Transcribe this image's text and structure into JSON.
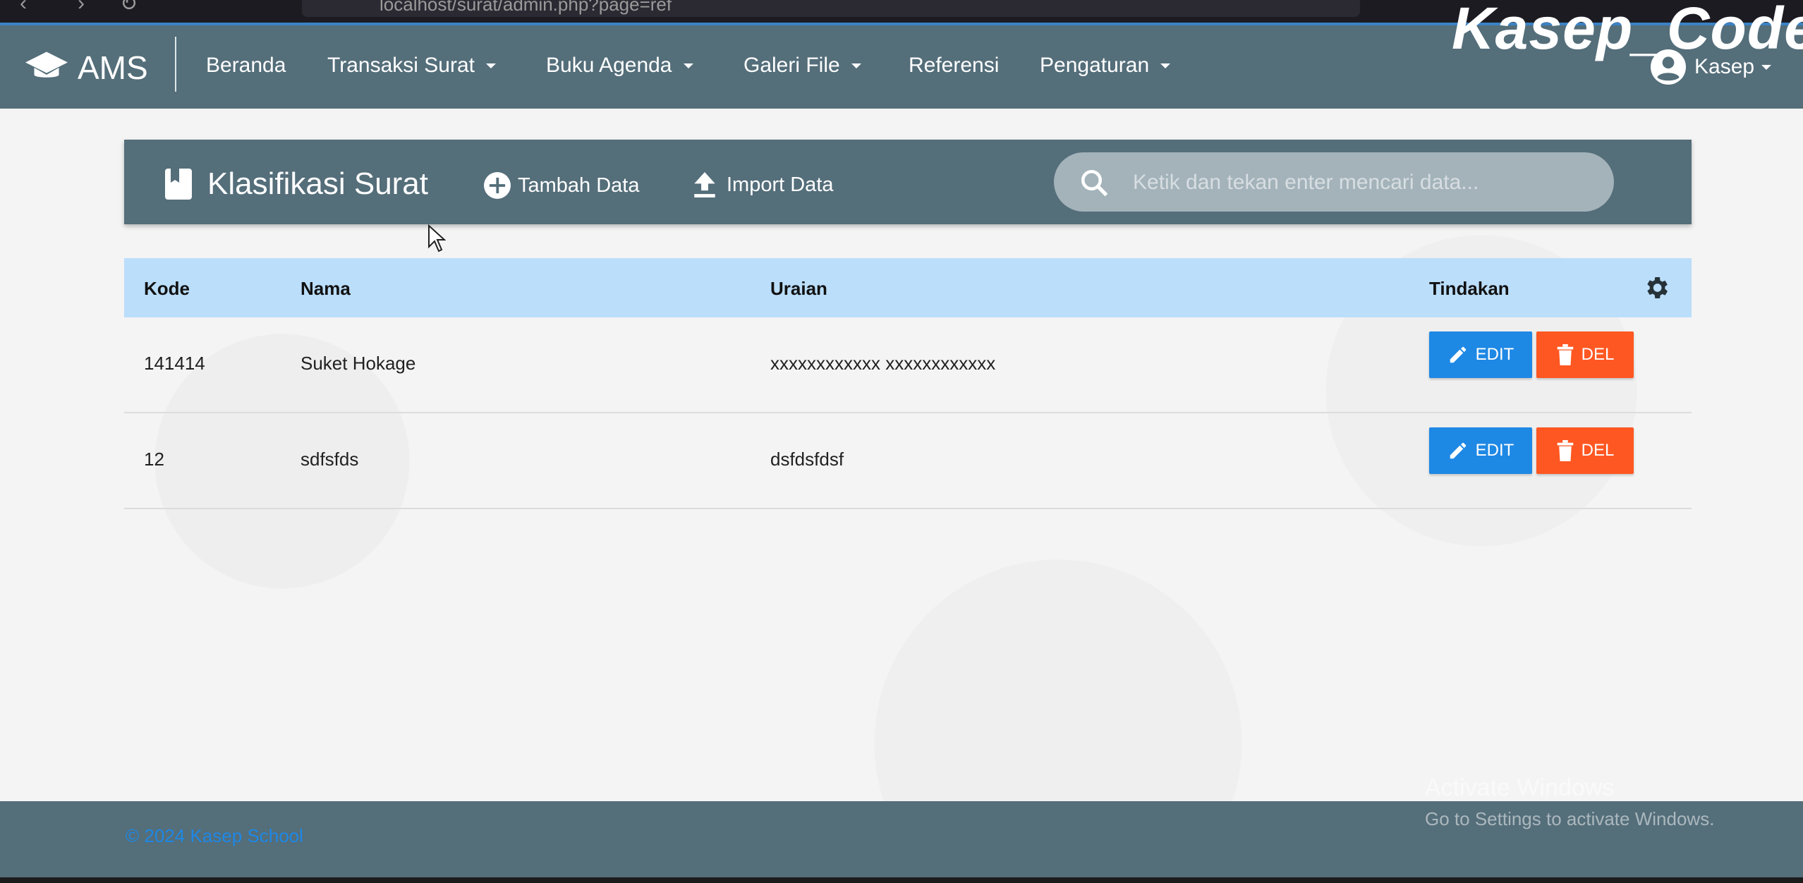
{
  "browser": {
    "url": "localhost/surat/admin.php?page=ref"
  },
  "watermark": "Kasep_Code",
  "navbar": {
    "brand": "AMS",
    "items": [
      {
        "label": "Beranda",
        "dropdown": false
      },
      {
        "label": "Transaksi Surat",
        "dropdown": true
      },
      {
        "label": "Buku Agenda",
        "dropdown": true
      },
      {
        "label": "Galeri File",
        "dropdown": true
      },
      {
        "label": "Referensi",
        "dropdown": false
      },
      {
        "label": "Pengaturan",
        "dropdown": true
      }
    ],
    "user": "Kasep"
  },
  "card": {
    "title": "Klasifikasi Surat",
    "add_label": "Tambah Data",
    "import_label": "Import Data",
    "search_placeholder": "Ketik dan tekan enter mencari data..."
  },
  "table": {
    "headers": [
      "Kode",
      "Nama",
      "Uraian",
      "Tindakan"
    ],
    "rows": [
      {
        "kode": "141414",
        "nama": "Suket Hokage",
        "uraian": "xxxxxxxxxxxx xxxxxxxxxxxx"
      },
      {
        "kode": "12",
        "nama": "sdfsfds",
        "uraian": "dsfdsfdsf"
      }
    ],
    "edit_label": "EDIT",
    "del_label": "DEL"
  },
  "footer": {
    "copyright": "© 2024 Kasep School"
  },
  "windows_notice": {
    "title": "Activate Windows",
    "subtitle": "Go to Settings to activate Windows."
  },
  "colors": {
    "navbar": "#546e7a",
    "table_header": "#bbdefb",
    "edit_button": "#1e88e5",
    "delete_button": "#ff5722"
  },
  "icons": [
    "graduation-cap-icon",
    "bookmark-icon",
    "add-circle-icon",
    "upload-icon",
    "search-icon",
    "settings-gear-icon",
    "pencil-icon",
    "trash-icon",
    "account-circle-icon"
  ]
}
